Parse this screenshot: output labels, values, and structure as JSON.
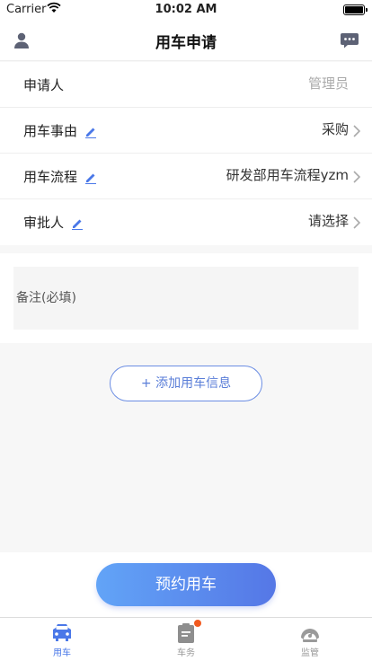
{
  "status_bar": {
    "carrier": "Carrier",
    "time": "10:02 AM"
  },
  "nav": {
    "title": "用车申请",
    "left_icon": "user-icon",
    "right_icon": "message-icon"
  },
  "form": {
    "rows": [
      {
        "label": "申请人",
        "value": "管理员",
        "editable": false,
        "placeholder_style": true,
        "chevron": false
      },
      {
        "label": "用车事由",
        "value": "采购",
        "editable": true,
        "chevron": true
      },
      {
        "label": "用车流程",
        "value": "研发部用车流程yzm",
        "editable": true,
        "chevron": true
      },
      {
        "label": "审批人",
        "value": "请选择",
        "editable": true,
        "chevron": true
      }
    ]
  },
  "remark": {
    "placeholder": "备注(必填)"
  },
  "add_vehicle_label": "+ 添加用车信息",
  "reserve_label": "预约用车",
  "tabs": [
    {
      "label": "用车",
      "icon": "car-icon",
      "active": true,
      "badge": false
    },
    {
      "label": "车务",
      "icon": "clipboard-icon",
      "active": false,
      "badge": true
    },
    {
      "label": "监管",
      "icon": "gauge-icon",
      "active": false,
      "badge": false
    }
  ],
  "colors": {
    "accent": "#4a78e8",
    "button_gradient_start": "#62a4f7",
    "button_gradient_end": "#5577e6",
    "badge": "#f25a1f"
  }
}
